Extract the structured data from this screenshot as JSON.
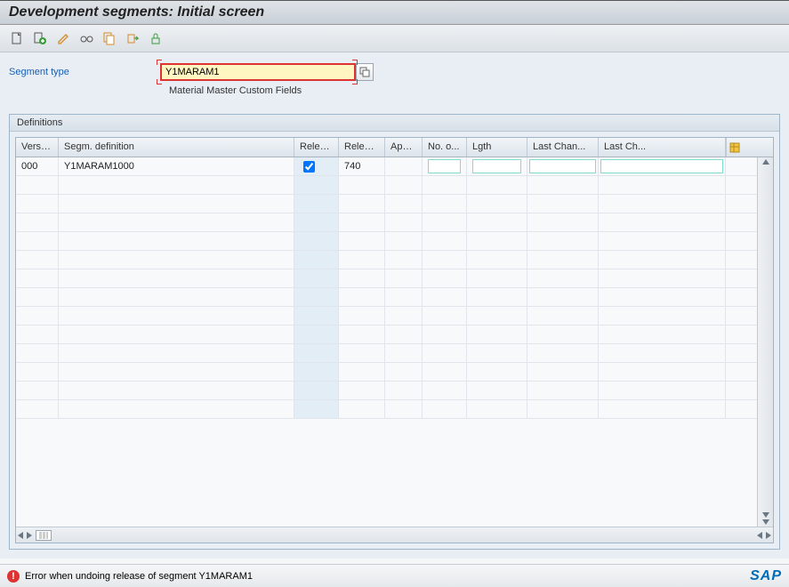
{
  "title": "Development segments: Initial screen",
  "toolbar": {
    "icons": [
      "create",
      "check",
      "edit",
      "glasses",
      "copy",
      "activate",
      "lock"
    ]
  },
  "segment": {
    "label": "Segment type",
    "value": "Y1MARAM1",
    "description": "Material Master Custom Fields"
  },
  "panel": {
    "title": "Definitions",
    "columns": {
      "version": "Version",
      "segdef": "Segm. definition",
      "rel1": "Release",
      "rel2": "Release",
      "appl": "Appl....",
      "no": "No. o...",
      "lgth": "Lgth",
      "lastChangedBy": "Last Chan...",
      "lastChangedOn": "Last Ch..."
    },
    "rows": [
      {
        "version": "000",
        "segdef": "Y1MARAM1000",
        "released": true,
        "release": "740",
        "appl": "",
        "no": "",
        "lgth": "",
        "lastChangedBy": "",
        "lastChangedOn": ""
      }
    ]
  },
  "status": {
    "message": "Error when undoing release of segment Y1MARAM1"
  },
  "icons": {
    "error": "!",
    "f4": "▢"
  }
}
